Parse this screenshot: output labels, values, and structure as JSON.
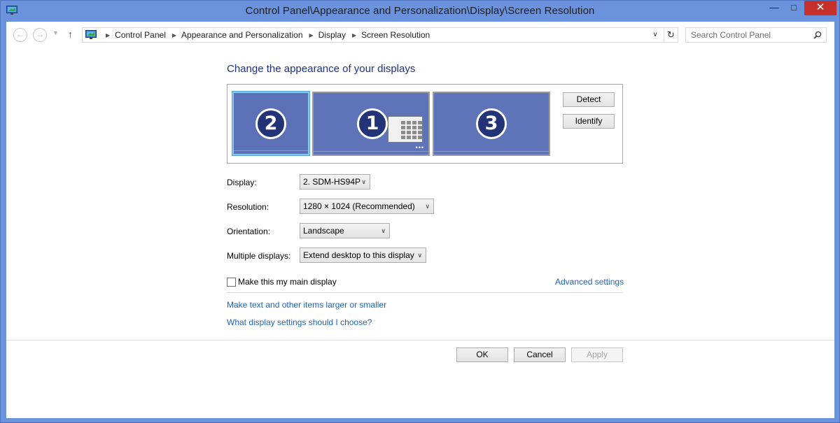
{
  "window": {
    "title": "Control Panel\\Appearance and Personalization\\Display\\Screen Resolution",
    "min_glyph": "—",
    "max_glyph": "□",
    "close_glyph": "✕"
  },
  "nav": {
    "back_glyph": "←",
    "forward_glyph": "→",
    "recent_glyph": "▼",
    "up_glyph": "↑",
    "breadcrumbs": [
      "Control Panel",
      "Appearance and Personalization",
      "Display",
      "Screen Resolution"
    ],
    "sep_glyph": "▶",
    "dropdown_glyph": "∨",
    "refresh_glyph": "↻",
    "search_placeholder": "Search Control Panel"
  },
  "main": {
    "heading": "Change the appearance of your displays",
    "monitors": [
      {
        "number": "2",
        "selected": true
      },
      {
        "number": "1",
        "selected": false,
        "primary": true,
        "dots": "•••"
      },
      {
        "number": "3",
        "selected": false
      }
    ],
    "detect_label": "Detect",
    "identify_label": "Identify",
    "display": {
      "label": "Display:",
      "value": "2. SDM-HS94P"
    },
    "resolution": {
      "label": "Resolution:",
      "value": "1280 × 1024 (Recommended)"
    },
    "orientation": {
      "label": "Orientation:",
      "value": "Landscape"
    },
    "multiple": {
      "label": "Multiple displays:",
      "value": "Extend desktop to this display"
    },
    "select_arrow": "∨",
    "main_display_label": "Make this my main display",
    "main_display_checked": false,
    "advanced_link": "Advanced settings",
    "text_size_link": "Make text and other items larger or smaller",
    "help_link": "What display settings should I choose?"
  },
  "footer": {
    "ok_label": "OK",
    "cancel_label": "Cancel",
    "apply_label": "Apply",
    "apply_enabled": false
  },
  "colors": {
    "frame": "#6b92dc",
    "close_button": "#c7312b",
    "heading": "#1e3287",
    "link": "#1e64b4",
    "monitor_fill": "#5f74b8",
    "selected_border": "#88c6ee"
  }
}
